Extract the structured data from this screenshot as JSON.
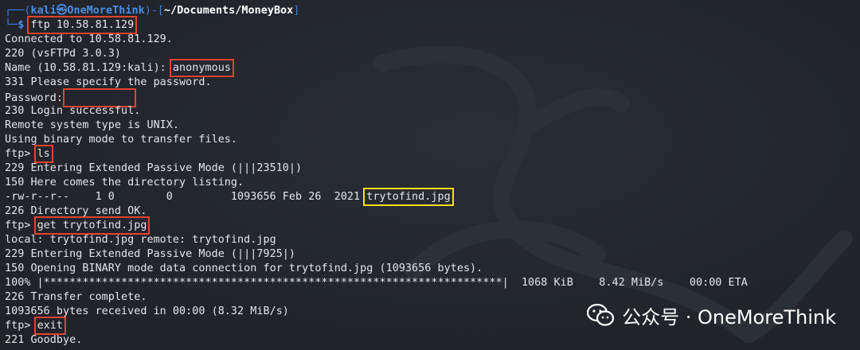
{
  "prompt": {
    "user": "kali",
    "at": "㉿",
    "host": "OneMoreThink",
    "cwd": "~/Documents/MoneyBox",
    "dollar": "$"
  },
  "lines": [
    {
      "text": "ftp 10.58.81.129",
      "kind": "command"
    },
    {
      "text": "Connected to 10.58.81.129."
    },
    {
      "text": "220 (vsFTPd 3.0.3)"
    },
    {
      "text": "Name (10.58.81.129:kali): ",
      "input": "anonymous"
    },
    {
      "text": "331 Please specify the password."
    },
    {
      "text": "Password:",
      "kind": "password"
    },
    {
      "text": "230 Login successful."
    },
    {
      "text": "Remote system type is UNIX."
    },
    {
      "text": "Using binary mode to transfer files."
    },
    {
      "text": "ftp> ",
      "input": "ls"
    },
    {
      "text": "229 Entering Extended Passive Mode (|||23510|)"
    },
    {
      "text": "150 Here comes the directory listing."
    },
    {
      "text": "-rw-r--r--    1 0        0         1093656 Feb 26  2021 ",
      "file": "trytofind.jpg"
    },
    {
      "text": "226 Directory send OK."
    },
    {
      "text": "ftp> ",
      "input": "get trytofind.jpg"
    },
    {
      "text": "local: trytofind.jpg remote: trytofind.jpg"
    },
    {
      "text": "229 Entering Extended Passive Mode (|||7925|)"
    },
    {
      "text": "150 Opening BINARY mode data connection for trytofind.jpg (1093656 bytes)."
    },
    {
      "text": "100% |***********************************************************************|  1068 KiB    8.42 MiB/s    00:00 ETA"
    },
    {
      "text": "226 Transfer complete."
    },
    {
      "text": "1093656 bytes received in 00:00 (8.32 MiB/s)"
    },
    {
      "text": "ftp> ",
      "input": "exit"
    },
    {
      "text": "221 Goodbye."
    }
  ],
  "watermark": {
    "text": "公众号 · OneMoreThink",
    "icon": "wechat-icon"
  }
}
